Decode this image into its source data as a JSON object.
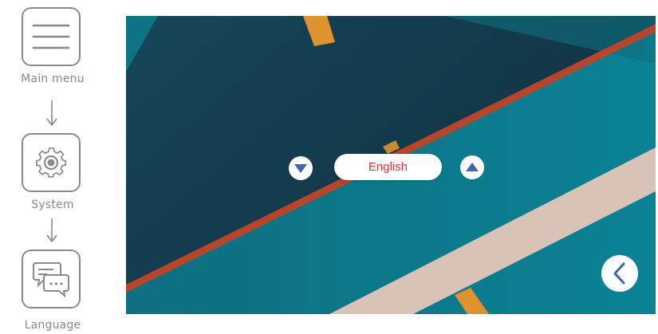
{
  "steps": {
    "main_menu": {
      "label": "Main menu",
      "icon": "hamburger-icon"
    },
    "system": {
      "label": "System",
      "icon": "gear-icon"
    },
    "language": {
      "label": "Language",
      "icon": "chat-bubbles-icon"
    }
  },
  "language_selector": {
    "selected": "English",
    "previous_icon": "triangle-down-icon",
    "next_icon": "triangle-up-icon"
  },
  "back_button": {
    "icon": "chevron-left-icon"
  },
  "colors": {
    "frame": "#8a8a8a",
    "selected_text": "#e2323a",
    "arrow_buttons": "#3f64b0",
    "screen_teal": "#0b7d8c",
    "screen_dark": "#133f4f",
    "stripe_orange": "#e0922e",
    "stripe_red": "#b8442a",
    "stripe_beige": "#d8c3b6"
  }
}
